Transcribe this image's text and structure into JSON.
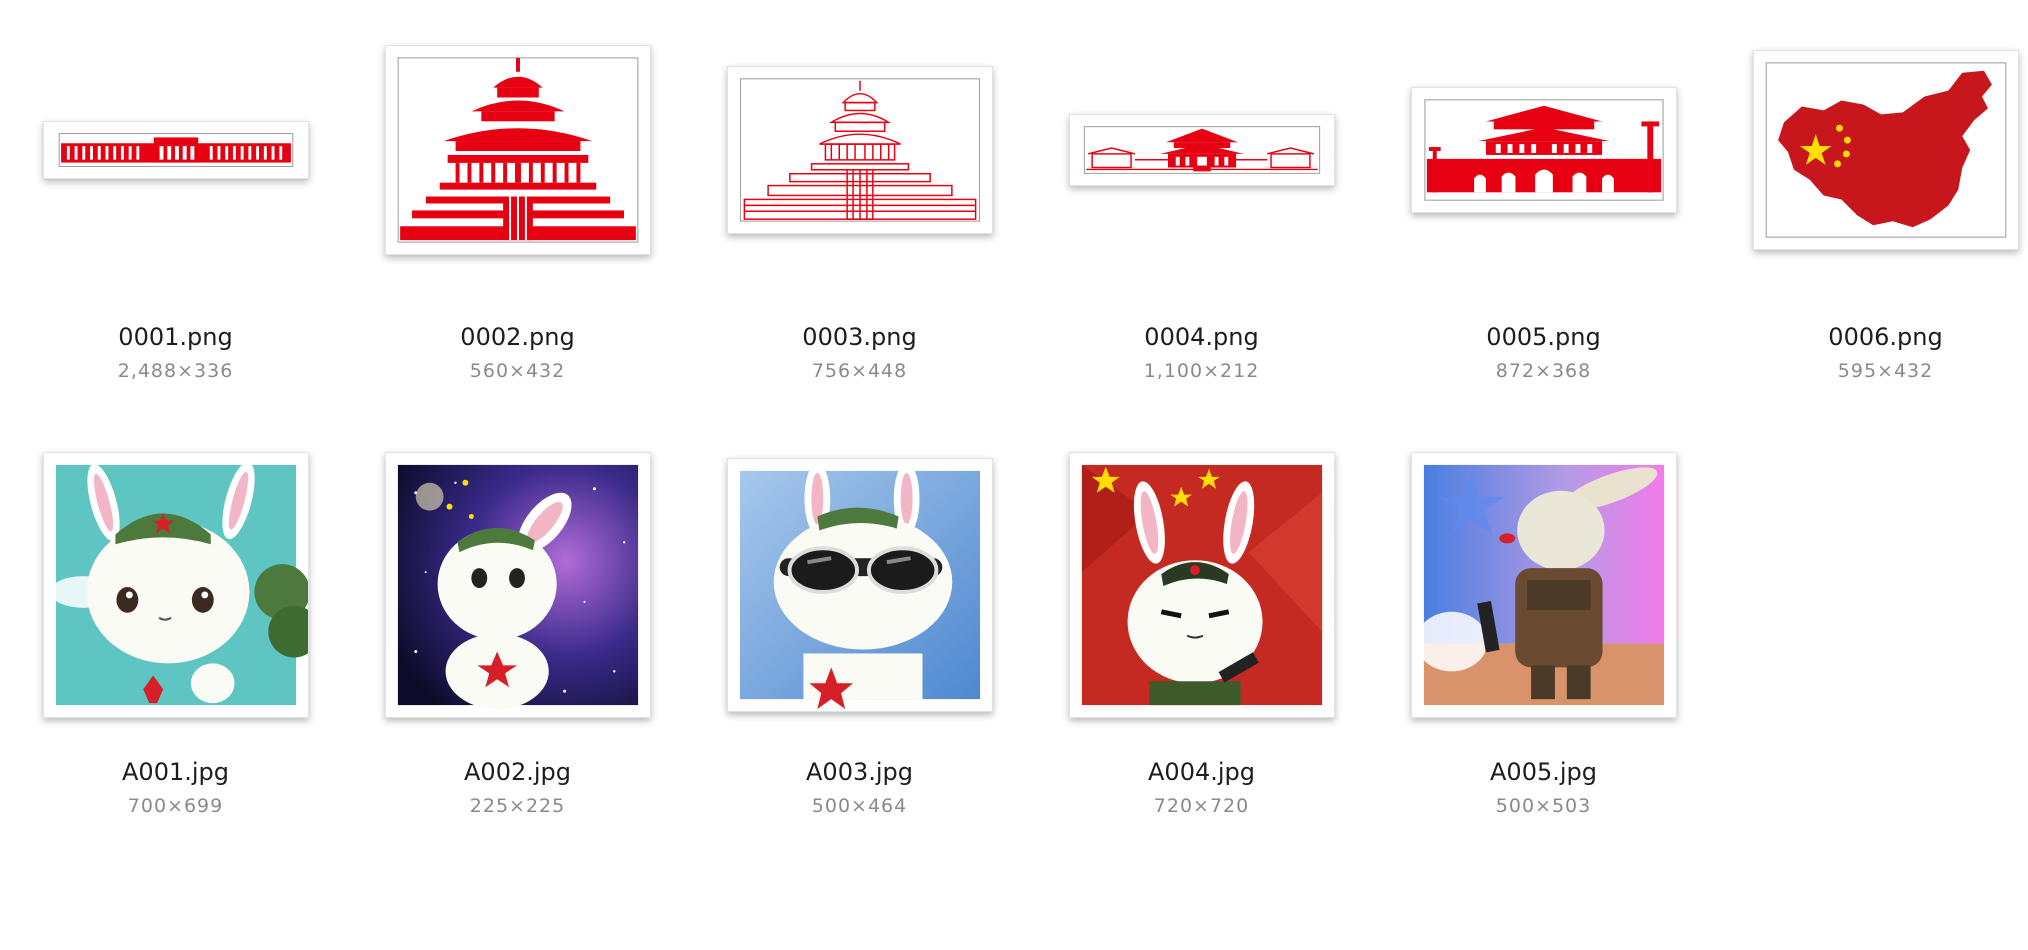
{
  "files": [
    {
      "name": "0001.png",
      "dims": "2,488×336",
      "icon": "building-hall-icon"
    },
    {
      "name": "0002.png",
      "dims": "560×432",
      "icon": "temple-of-heaven-icon"
    },
    {
      "name": "0003.png",
      "dims": "756×448",
      "icon": "temple-of-heaven-detailed-icon"
    },
    {
      "name": "0004.png",
      "dims": "1,100×212",
      "icon": "palace-panorama-icon"
    },
    {
      "name": "0005.png",
      "dims": "872×368",
      "icon": "tiananmen-gate-icon"
    },
    {
      "name": "0006.png",
      "dims": "595×432",
      "icon": "china-map-flag-icon"
    },
    {
      "name": "A001.jpg",
      "dims": "700×699",
      "icon": "rabbit-cap-icon"
    },
    {
      "name": "A002.jpg",
      "dims": "225×225",
      "icon": "rabbit-galaxy-icon"
    },
    {
      "name": "A003.jpg",
      "dims": "500×464",
      "icon": "rabbit-goggles-icon"
    },
    {
      "name": "A004.jpg",
      "dims": "720×720",
      "icon": "rabbit-soldier-flag-icon"
    },
    {
      "name": "A005.jpg",
      "dims": "500×503",
      "icon": "rabbit-armor-icon"
    }
  ],
  "colors": {
    "accent_red": "#e60012",
    "map_red": "#c8161d",
    "star_yellow": "#ffde00"
  }
}
